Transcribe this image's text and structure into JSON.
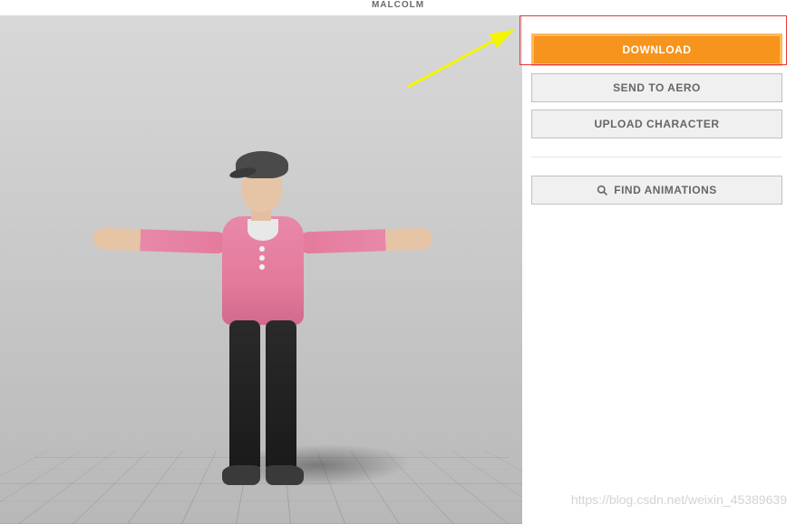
{
  "header": {
    "title": "MALCOLM"
  },
  "sidebar": {
    "download_label": "DOWNLOAD",
    "send_to_aero_label": "SEND TO AERO",
    "upload_character_label": "UPLOAD CHARACTER",
    "find_animations_label": "FIND ANIMATIONS"
  },
  "viewport": {
    "character_name": "Malcolm",
    "pose": "T-pose"
  },
  "watermark": "https://blog.csdn.net/weixin_45389639"
}
